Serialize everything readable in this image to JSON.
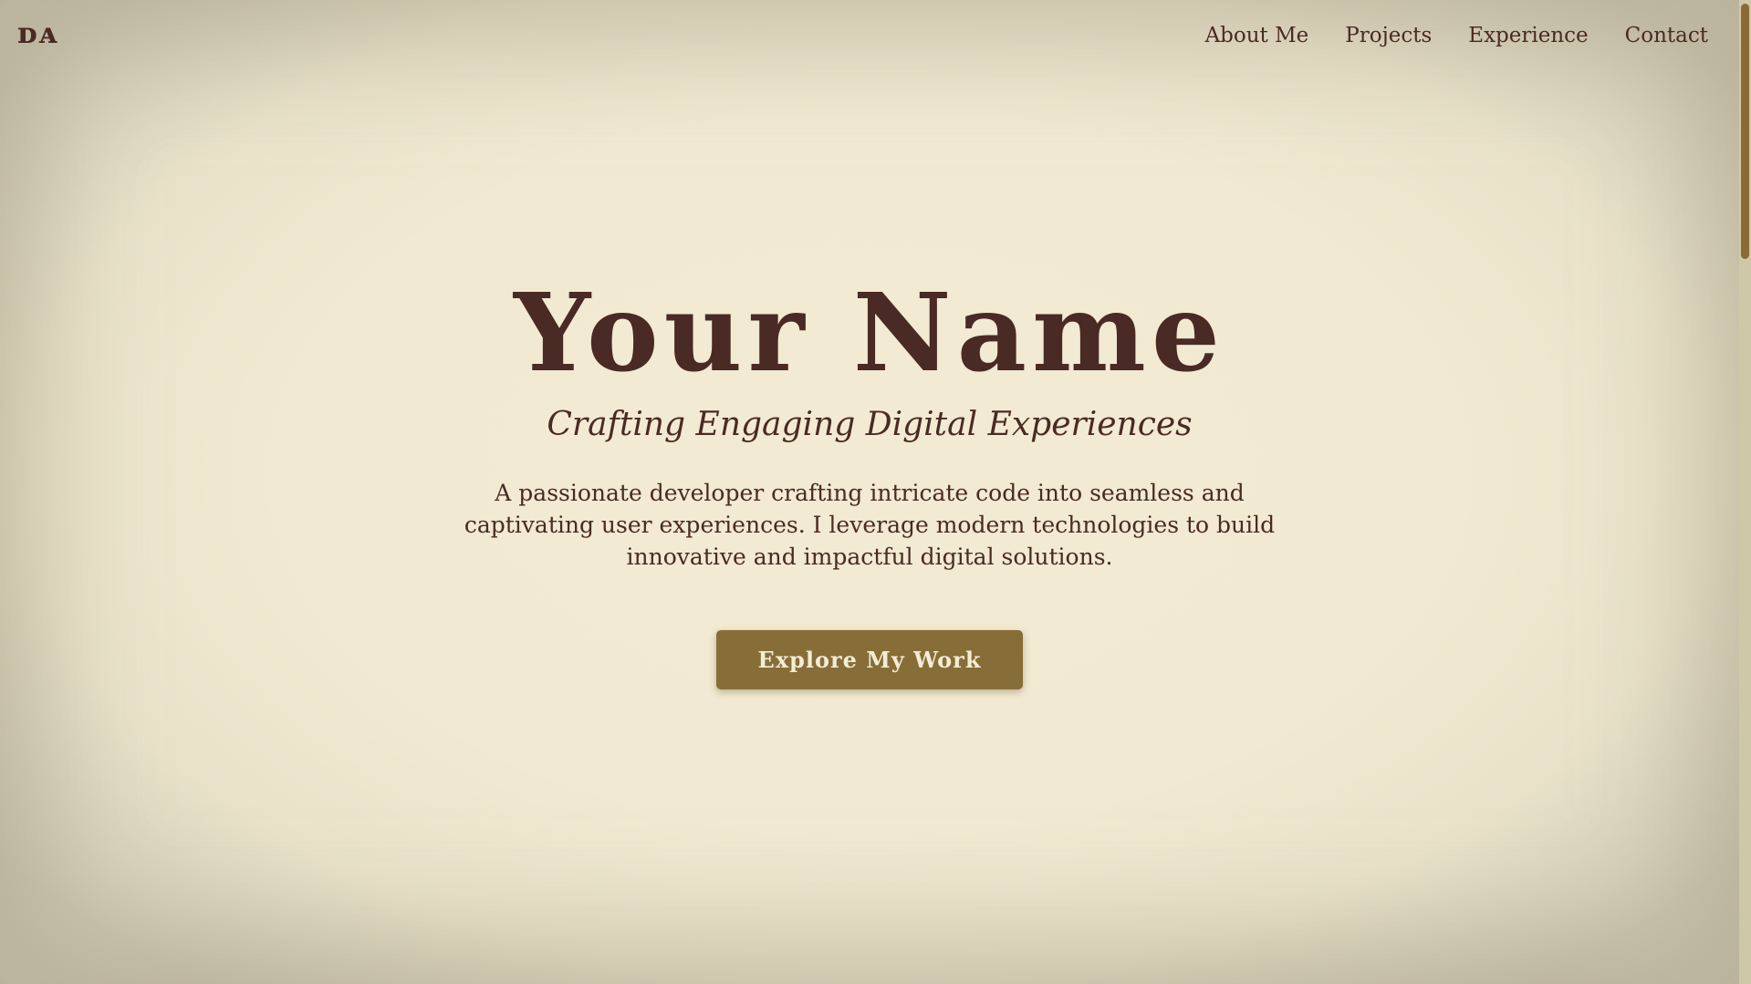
{
  "header": {
    "logo": "ᴅᴀ",
    "nav": [
      {
        "label": "About Me"
      },
      {
        "label": "Projects"
      },
      {
        "label": "Experience"
      },
      {
        "label": "Contact"
      }
    ]
  },
  "hero": {
    "title": "Your Name",
    "subtitle": "Crafting Engaging Digital Experiences",
    "description": "A passionate developer crafting intricate code into seamless and captivating user experiences. I leverage modern technologies to build innovative and impactful digital solutions.",
    "cta_label": "Explore My Work"
  },
  "colors": {
    "background": "#f1e9d2",
    "text": "#4a2a24",
    "accent": "#876d37",
    "button_text": "#f3ecd6"
  }
}
